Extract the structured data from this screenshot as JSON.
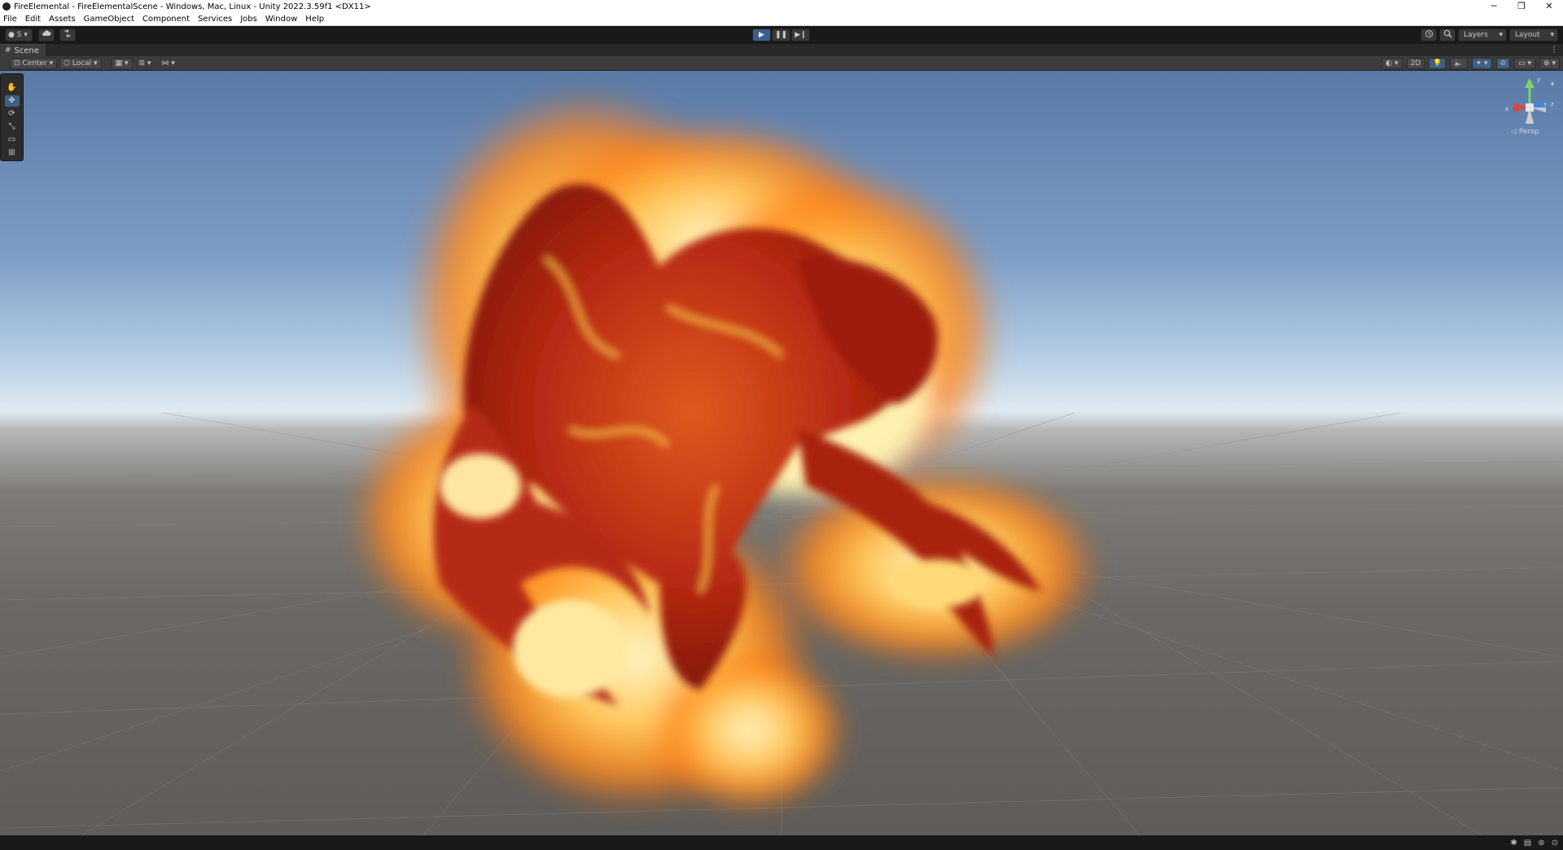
{
  "window": {
    "title": "FireElemental - FireElementalScene - Windows, Mac, Linux - Unity 2022.3.59f1 <DX11>",
    "controls": {
      "minimize": "─",
      "restore": "❐",
      "close": "✕"
    }
  },
  "menu": [
    "File",
    "Edit",
    "Assets",
    "GameObject",
    "Component",
    "Services",
    "Jobs",
    "Window",
    "Help"
  ],
  "toolbar": {
    "account": "S",
    "cloud_icon": "cloud-icon",
    "collab_icon": "version-control-icon",
    "play": "▶",
    "pause": "❚❚",
    "step": "▶❙",
    "history_icon": "history-icon",
    "search_icon": "search-icon",
    "layers": "Layers",
    "layout": "Layout"
  },
  "tabs": {
    "scene": "Scene"
  },
  "scene_toolbar": {
    "pivot": "Center",
    "space": "Local",
    "mode_2d": "2D"
  },
  "tools": [
    "hand-tool",
    "move-tool",
    "rotate-tool",
    "scale-tool",
    "rect-tool",
    "transform-tool"
  ],
  "gizmo": {
    "x": "x",
    "y": "y",
    "z": "z",
    "projection": "Persp"
  },
  "colors": {
    "accent": "#3a5f8a",
    "fire_core": "#ffe9a0",
    "fire_mid": "#ff9a28",
    "creature_red": "#b82a12"
  }
}
